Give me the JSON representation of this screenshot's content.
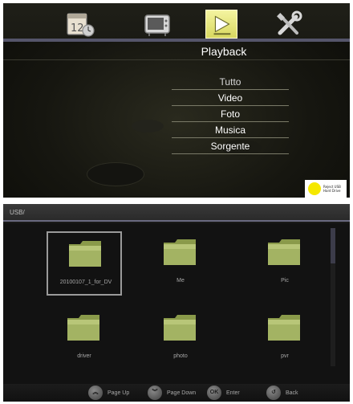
{
  "top_menu": {
    "icons": [
      {
        "name": "calendar-clock-icon"
      },
      {
        "name": "tv-icon"
      },
      {
        "name": "playback-icon",
        "active": true
      },
      {
        "name": "tools-icon"
      }
    ],
    "title": "Playback",
    "items": [
      {
        "label": "Tutto",
        "selected": true
      },
      {
        "label": "Video"
      },
      {
        "label": "Foto"
      },
      {
        "label": "Musica"
      },
      {
        "label": "Sorgente"
      }
    ],
    "hdd_badge": {
      "icon": "hdd-dot-icon",
      "text": "Reject USB Hard Drive"
    }
  },
  "browser": {
    "path": "USB/",
    "folders": [
      {
        "name": "20100107_1_for_DV",
        "focused": true
      },
      {
        "name": "Me"
      },
      {
        "name": "Pic"
      },
      {
        "name": "driver"
      },
      {
        "name": "photo"
      },
      {
        "name": "pvr"
      }
    ],
    "footer": {
      "page_up": {
        "icon": "double-up-icon",
        "label": "Page Up"
      },
      "page_down": {
        "icon": "double-down-icon",
        "label": "Page Down"
      },
      "enter": {
        "key": "OK",
        "label": "Enter"
      },
      "back": {
        "icon": "back-icon",
        "label": "Back"
      }
    }
  },
  "colors": {
    "accent_rule": "#55556a",
    "folder_fill": "#9fae5f",
    "active_tab": "#e8e87a",
    "hdd_dot": "#f5e800"
  }
}
